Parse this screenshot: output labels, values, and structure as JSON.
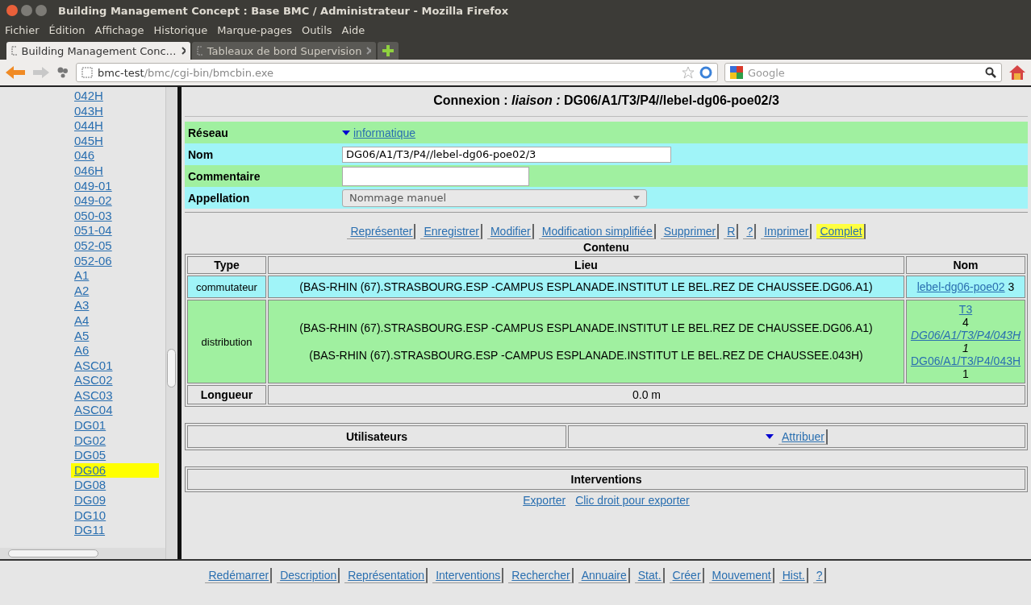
{
  "window": {
    "title": "Building Management Concept : Base BMC / Administrateur - Mozilla Firefox"
  },
  "menu": [
    "Fichier",
    "Édition",
    "Affichage",
    "Historique",
    "Marque-pages",
    "Outils",
    "Aide"
  ],
  "tabs": [
    {
      "label": "Building Management Conc…",
      "selected": true
    },
    {
      "label": "Tableaux de bord Supervision",
      "selected": false
    }
  ],
  "address": {
    "host": "bmc-test",
    "path": "/bmc/cgi-bin/bmcbin.exe"
  },
  "search": {
    "placeholder": "Google"
  },
  "sidebar": {
    "items": [
      {
        "label": "042H",
        "selected": false
      },
      {
        "label": "043H",
        "selected": false
      },
      {
        "label": "044H",
        "selected": false
      },
      {
        "label": "045H",
        "selected": false
      },
      {
        "label": "046",
        "selected": false
      },
      {
        "label": "046H",
        "selected": false
      },
      {
        "label": "049-01",
        "selected": false
      },
      {
        "label": "049-02",
        "selected": false
      },
      {
        "label": "050-03",
        "selected": false
      },
      {
        "label": "051-04",
        "selected": false
      },
      {
        "label": "052-05",
        "selected": false
      },
      {
        "label": "052-06",
        "selected": false
      },
      {
        "label": "A1",
        "selected": false
      },
      {
        "label": "A2",
        "selected": false
      },
      {
        "label": "A3",
        "selected": false
      },
      {
        "label": "A4",
        "selected": false
      },
      {
        "label": "A5",
        "selected": false
      },
      {
        "label": "A6",
        "selected": false
      },
      {
        "label": "ASC01",
        "selected": false
      },
      {
        "label": "ASC02",
        "selected": false
      },
      {
        "label": "ASC03",
        "selected": false
      },
      {
        "label": "ASC04",
        "selected": false
      },
      {
        "label": "DG01",
        "selected": false
      },
      {
        "label": "DG02",
        "selected": false
      },
      {
        "label": "DG05",
        "selected": false
      },
      {
        "label": "DG06",
        "selected": true
      },
      {
        "label": "DG08",
        "selected": false
      },
      {
        "label": "DG09",
        "selected": false
      },
      {
        "label": "DG10",
        "selected": false
      },
      {
        "label": "DG11",
        "selected": false
      }
    ]
  },
  "heading": "Connexion : *liaison :* DG06/A1/T3/P4//lebel-dg06-poe02/3",
  "form": [
    {
      "label": "Réseau",
      "kind": "dropdown-link",
      "value": "informatique",
      "color": "#a0f0a0"
    },
    {
      "label": "Nom",
      "kind": "text",
      "value": "DG06/A1/T3/P4//lebel-dg06-poe02/3",
      "color": "#a0f4f8"
    },
    {
      "label": "Commentaire",
      "kind": "textarea",
      "color": "#a0f0a0"
    },
    {
      "label": "Appellation",
      "kind": "select",
      "value": "Nommage manuel",
      "color": "#a0f4f8"
    }
  ],
  "actions": [
    {
      "label": "Représenter",
      "selected": false
    },
    {
      "label": "Enregistrer",
      "selected": false
    },
    {
      "label": "Modifier",
      "selected": false
    },
    {
      "label": "Modification simplifiée",
      "selected": false
    },
    {
      "label": "Supprimer",
      "selected": false
    },
    {
      "label": "R",
      "selected": false
    },
    {
      "label": "?",
      "selected": false
    },
    {
      "label": "Imprimer",
      "selected": false
    },
    {
      "label": "Complet",
      "selected": true
    }
  ],
  "contents": {
    "title": "Contenu",
    "columns": [
      "Type",
      "Lieu",
      "Nom"
    ],
    "rows": [
      {
        "type": "commutateur",
        "color": "#a0f4f8",
        "lieu": [
          "(BAS-RHIN (67).STRASBOURG.ESP -CAMPUS ESPLANADE.INSTITUT LE BEL.REZ DE CHAUSSEE.DG06.A1)"
        ],
        "nom": [
          {
            "link": "lebel-dg06-poe02",
            "text": "3",
            "italic": false
          }
        ]
      },
      {
        "type": "distribution",
        "color": "#a0f0a0",
        "lieu": [
          "(BAS-RHIN (67).STRASBOURG.ESP -CAMPUS ESPLANADE.INSTITUT LE BEL.REZ DE CHAUSSEE.DG06.A1)",
          "(BAS-RHIN (67).STRASBOURG.ESP -CAMPUS ESPLANADE.INSTITUT LE BEL.REZ DE CHAUSSEE.043H)"
        ],
        "nom": [
          {
            "link": "T3",
            "text": "4",
            "italic": false
          },
          {
            "link": "DG06/A1/T3/P4/043H",
            "text": "1",
            "italic": true
          },
          {
            "link": "DG06/A1/T3/P4/043H",
            "text": "1",
            "italic": false
          }
        ]
      }
    ],
    "length": {
      "label": "Longueur",
      "value": "0.0 m"
    }
  },
  "users": {
    "label": "Utilisateurs",
    "button": "Attribuer"
  },
  "interventions": {
    "label": "Interventions",
    "links": [
      "Exporter",
      "Clic droit pour exporter"
    ]
  },
  "bottom_buttons": [
    "Redémarrer",
    "Description",
    "Représentation",
    "Interventions",
    "Rechercher",
    "Annuaire",
    "Stat.",
    "Créer",
    "Mouvement",
    "Hist.",
    "?"
  ]
}
